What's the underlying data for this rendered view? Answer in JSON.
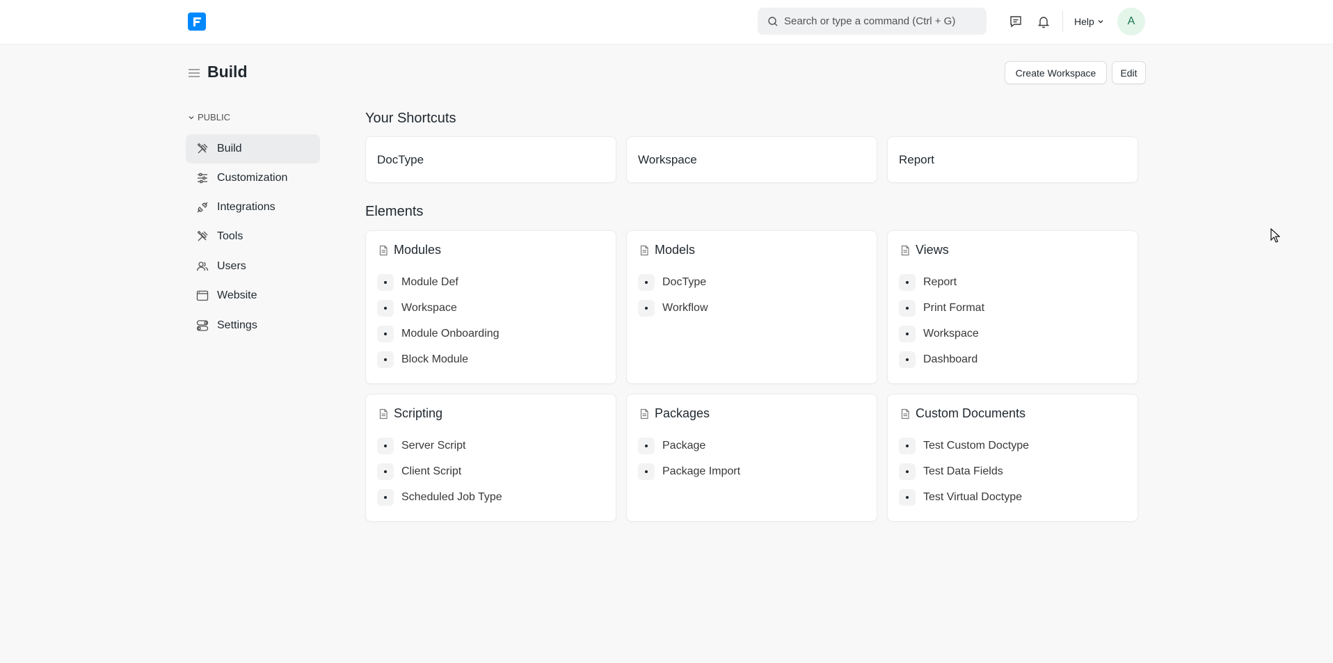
{
  "navbar": {
    "logo_icon": "frappe-logo-icon",
    "search_placeholder": "Search or type a command (Ctrl + G)",
    "help_label": "Help",
    "avatar_initial": "A",
    "accent_color": "#0089ff"
  },
  "page": {
    "title": "Build",
    "create_workspace_label": "Create Workspace",
    "edit_label": "Edit"
  },
  "sidebar": {
    "section_label": "PUBLIC",
    "items": [
      {
        "label": "Build",
        "icon": "tools-icon",
        "active": true
      },
      {
        "label": "Customization",
        "icon": "sliders-icon"
      },
      {
        "label": "Integrations",
        "icon": "plug-icon"
      },
      {
        "label": "Tools",
        "icon": "tools-icon"
      },
      {
        "label": "Users",
        "icon": "users-icon"
      },
      {
        "label": "Website",
        "icon": "browser-icon"
      },
      {
        "label": "Settings",
        "icon": "toggles-icon"
      }
    ]
  },
  "shortcuts": {
    "title": "Your Shortcuts",
    "items": [
      {
        "label": "DocType"
      },
      {
        "label": "Workspace"
      },
      {
        "label": "Report"
      }
    ]
  },
  "elements": {
    "title": "Elements",
    "cards": [
      {
        "title": "Modules",
        "links": [
          "Module Def",
          "Workspace",
          "Module Onboarding",
          "Block Module"
        ]
      },
      {
        "title": "Models",
        "links": [
          "DocType",
          "Workflow"
        ]
      },
      {
        "title": "Views",
        "links": [
          "Report",
          "Print Format",
          "Workspace",
          "Dashboard"
        ]
      },
      {
        "title": "Scripting",
        "links": [
          "Server Script",
          "Client Script",
          "Scheduled Job Type"
        ]
      },
      {
        "title": "Packages",
        "links": [
          "Package",
          "Package Import"
        ]
      },
      {
        "title": "Custom Documents",
        "links": [
          "Test Custom Doctype",
          "Test Data Fields",
          "Test Virtual Doctype"
        ]
      }
    ]
  }
}
